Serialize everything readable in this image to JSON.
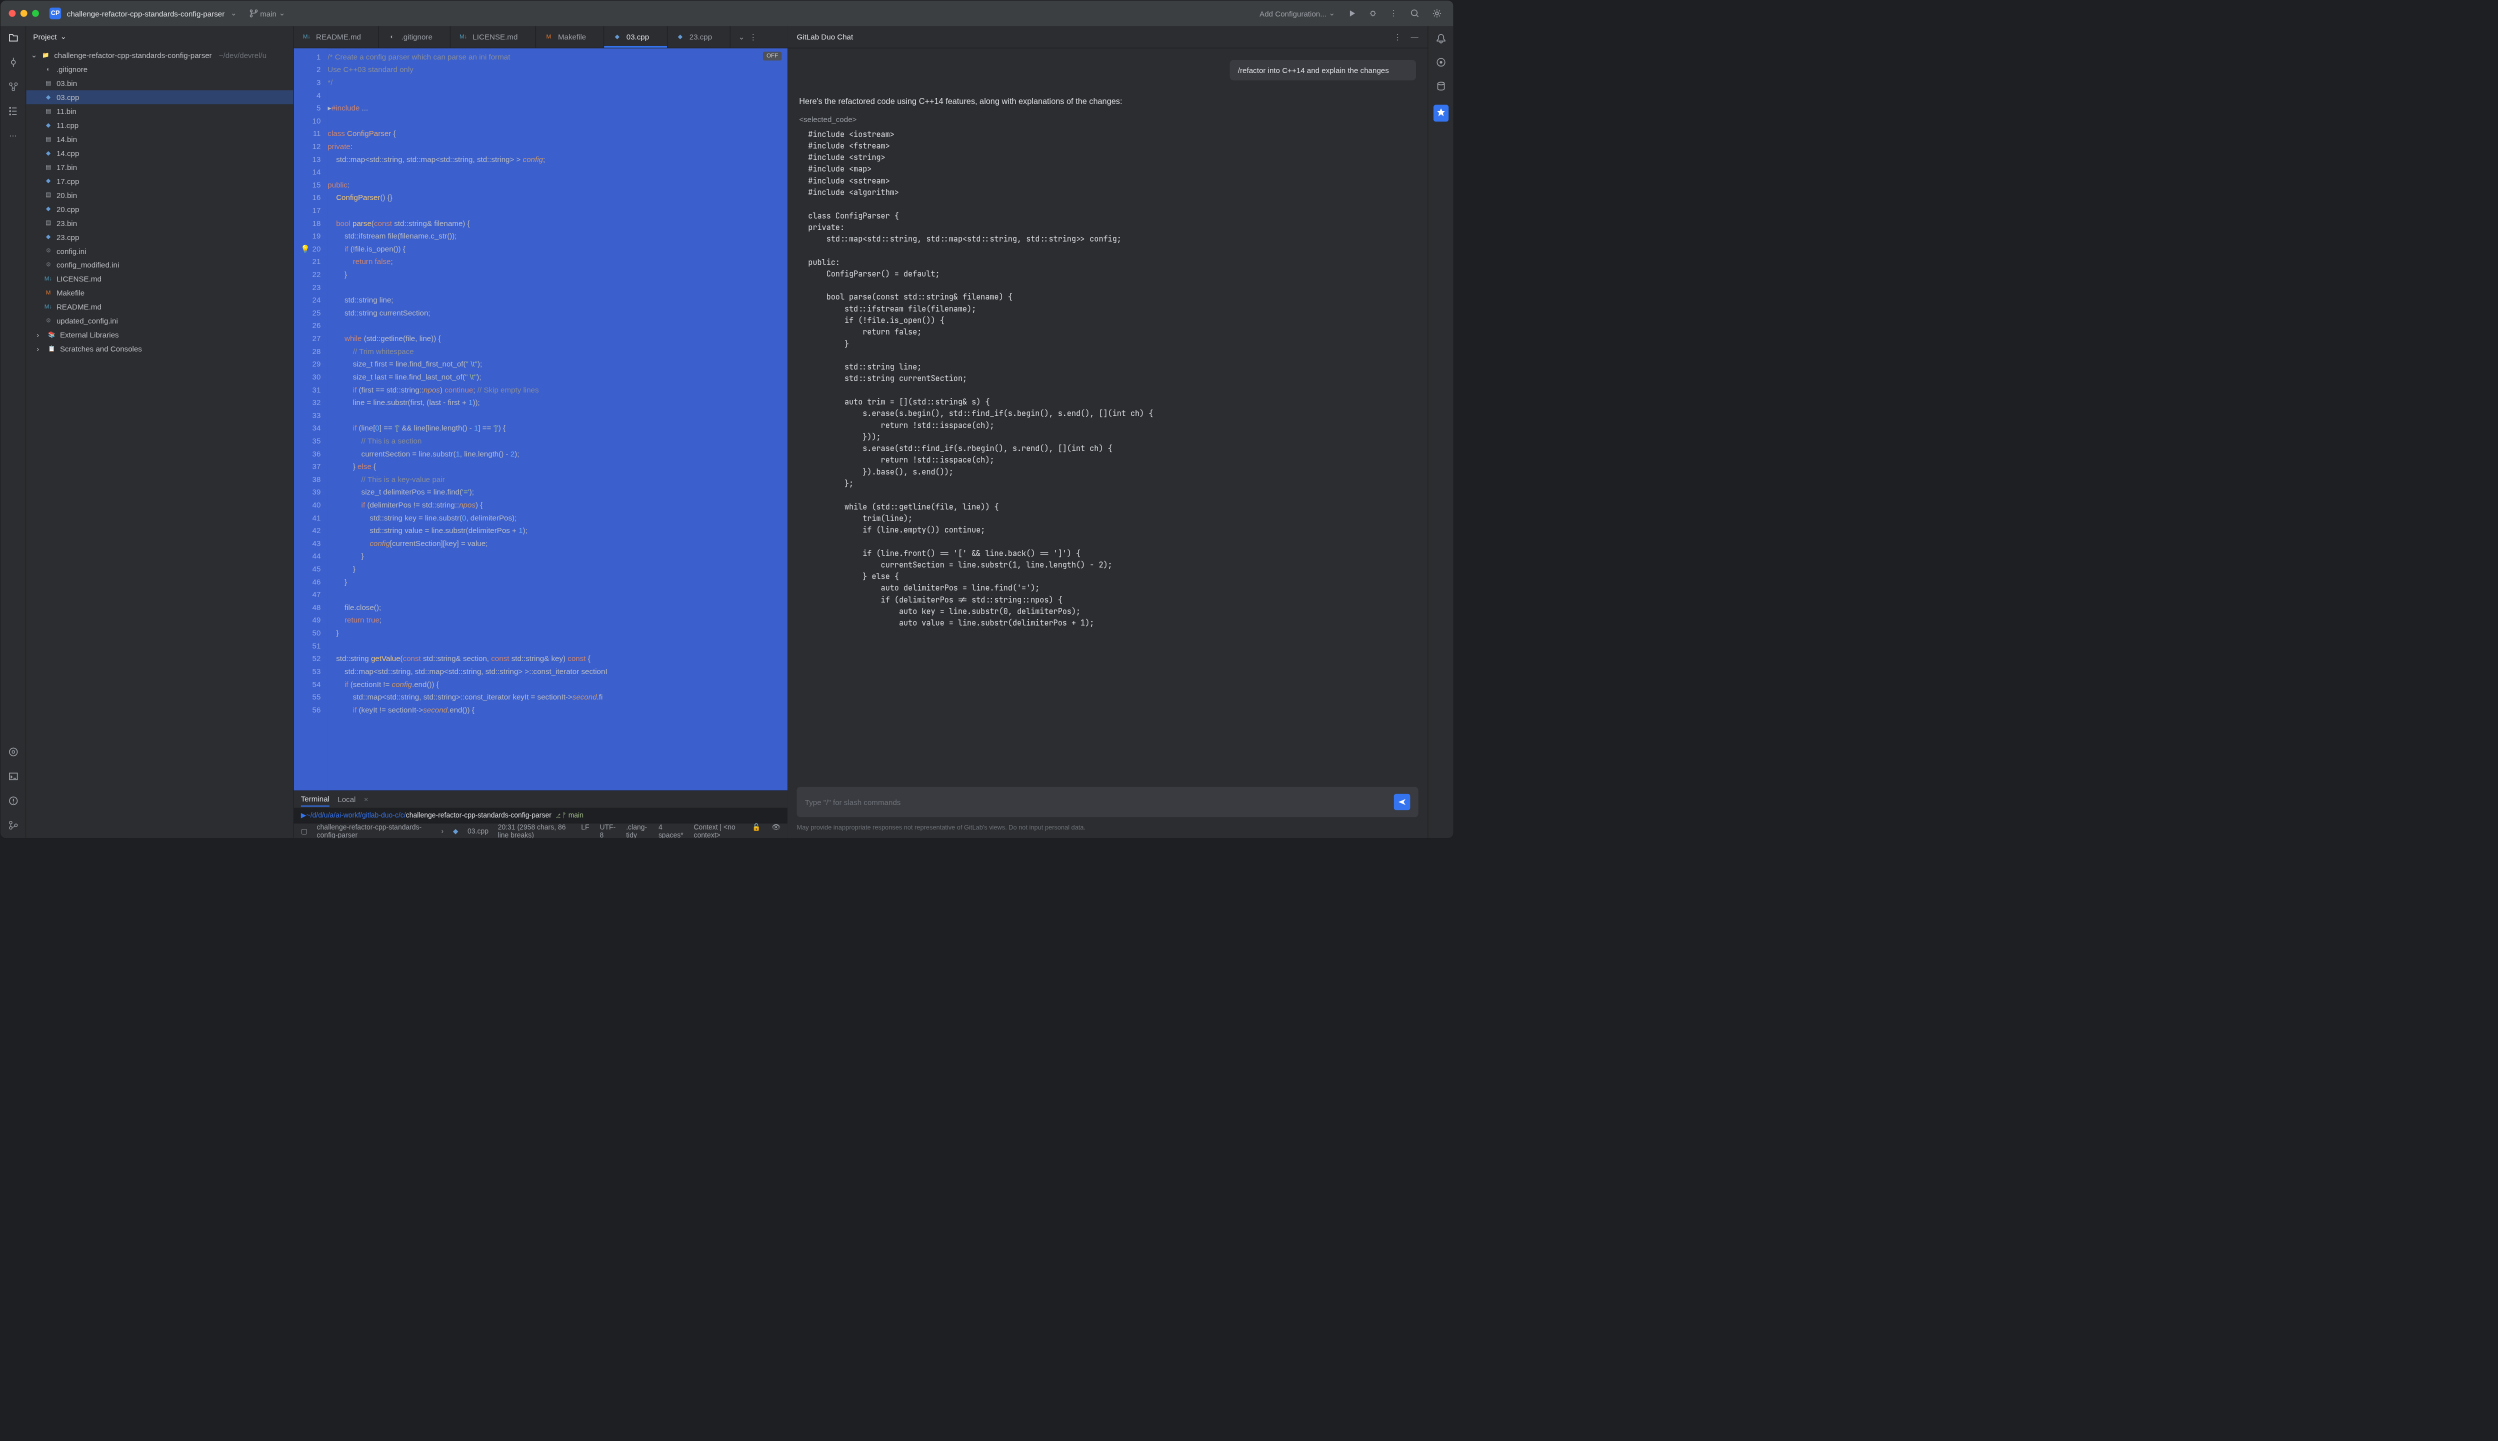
{
  "titlebar": {
    "project": "challenge-refactor-cpp-standards-config-parser",
    "badge": "CP",
    "branch": "main",
    "addConfig": "Add Configuration..."
  },
  "sidebar": {
    "header": "Project",
    "rootHint": "~/dev/devrel/u",
    "items": [
      {
        "name": ".gitignore",
        "icon": "file"
      },
      {
        "name": "03.bin",
        "icon": "bin"
      },
      {
        "name": "03.cpp",
        "icon": "cpp",
        "selected": true
      },
      {
        "name": "11.bin",
        "icon": "bin"
      },
      {
        "name": "11.cpp",
        "icon": "cpp"
      },
      {
        "name": "14.bin",
        "icon": "bin"
      },
      {
        "name": "14.cpp",
        "icon": "cpp"
      },
      {
        "name": "17.bin",
        "icon": "bin"
      },
      {
        "name": "17.cpp",
        "icon": "cpp"
      },
      {
        "name": "20.bin",
        "icon": "bin"
      },
      {
        "name": "20.cpp",
        "icon": "cpp"
      },
      {
        "name": "23.bin",
        "icon": "bin"
      },
      {
        "name": "23.cpp",
        "icon": "cpp"
      },
      {
        "name": "config.ini",
        "icon": "ini"
      },
      {
        "name": "config_modified.ini",
        "icon": "ini"
      },
      {
        "name": "LICENSE.md",
        "icon": "md"
      },
      {
        "name": "Makefile",
        "icon": "make"
      },
      {
        "name": "README.md",
        "icon": "md"
      },
      {
        "name": "updated_config.ini",
        "icon": "ini"
      }
    ],
    "libs": "External Libraries",
    "scratches": "Scratches and Consoles"
  },
  "tabs": [
    {
      "label": "README.md",
      "icon": "md"
    },
    {
      "label": ".gitignore",
      "icon": "file"
    },
    {
      "label": "LICENSE.md",
      "icon": "md"
    },
    {
      "label": "Makefile",
      "icon": "make"
    },
    {
      "label": "03.cpp",
      "icon": "cpp",
      "active": true
    },
    {
      "label": "23.cpp",
      "icon": "cpp"
    }
  ],
  "editor": {
    "offBadge": "OFF",
    "lines": [
      {
        "n": 1,
        "html": "<span class='cm-comment'>/* Create a config parser which can parse an ini format</span>"
      },
      {
        "n": 2,
        "html": "<span class='cm-comment'>Use C++03 standard only</span>"
      },
      {
        "n": 3,
        "html": "<span class='cm-comment'>*/</span>"
      },
      {
        "n": 4,
        "html": ""
      },
      {
        "n": 5,
        "html": "<span class='cm-op'>▸</span><span class='cm-keyword'>#include</span> ..."
      },
      {
        "n": 10,
        "html": ""
      },
      {
        "n": 11,
        "html": "<span class='cm-keyword'>class</span> <span class='cm-type'>ConfigParser</span> {"
      },
      {
        "n": 12,
        "html": "<span class='cm-keyword'>private</span>:"
      },
      {
        "n": 13,
        "html": "    std::map&lt;std::string, std::map&lt;std::string, std::string&gt; &gt; <span class='cm-npos'>config</span>;"
      },
      {
        "n": 14,
        "html": ""
      },
      {
        "n": 15,
        "html": "<span class='cm-keyword'>public</span>:"
      },
      {
        "n": 16,
        "html": "    <span class='cm-fn'>ConfigParser</span>() {}"
      },
      {
        "n": 17,
        "html": ""
      },
      {
        "n": 18,
        "html": "    <span class='cm-keyword'>bool</span> <span class='cm-fn'>parse</span>(<span class='cm-keyword'>const</span> std::string&amp; filename) {"
      },
      {
        "n": 19,
        "html": "        std::ifstream file(filename.c_str());"
      },
      {
        "n": 20,
        "html": "        <span class='cm-keyword'>if</span> (!file.is_open()) {",
        "bulb": true
      },
      {
        "n": 21,
        "html": "            <span class='cm-keyword'>return</span> <span class='cm-keyword'>false</span>;"
      },
      {
        "n": 22,
        "html": "        }"
      },
      {
        "n": 23,
        "html": ""
      },
      {
        "n": 24,
        "html": "        std::string line;"
      },
      {
        "n": 25,
        "html": "        std::string currentSection;"
      },
      {
        "n": 26,
        "html": ""
      },
      {
        "n": 27,
        "html": "        <span class='cm-keyword'>while</span> (std::getline(file, line)) {"
      },
      {
        "n": 28,
        "html": "            <span class='cm-comment'>// Trim whitespace</span>"
      },
      {
        "n": 29,
        "html": "            size_t first = line.find_first_not_of(<span class='cm-str'>\" \\t\"</span>);"
      },
      {
        "n": 30,
        "html": "            size_t last = line.find_last_not_of(<span class='cm-str'>\" \\t\"</span>);"
      },
      {
        "n": 31,
        "html": "            <span class='cm-keyword'>if</span> (first == std::string::<span class='cm-npos'>npos</span>) <span class='cm-keyword'>continue</span>; <span class='cm-comment'>// Skip empty lines</span>"
      },
      {
        "n": 32,
        "html": "            line = line.substr(first, (last - first + <span class='cm-num'>1</span>));"
      },
      {
        "n": 33,
        "html": ""
      },
      {
        "n": 34,
        "html": "            <span class='cm-keyword'>if</span> (line[<span class='cm-num'>0</span>] == <span class='cm-str'>'['</span> &amp;&amp; line[line.length() - <span class='cm-num'>1</span>] == <span class='cm-str'>']'</span>) {"
      },
      {
        "n": 35,
        "html": "                <span class='cm-comment'>// This is a section</span>"
      },
      {
        "n": 36,
        "html": "                currentSection = line.substr(<span class='cm-num'>1</span>, line.length() - <span class='cm-num'>2</span>);"
      },
      {
        "n": 37,
        "html": "            } <span class='cm-keyword'>else</span> {"
      },
      {
        "n": 38,
        "html": "                <span class='cm-comment'>// This is a key-value pair</span>"
      },
      {
        "n": 39,
        "html": "                size_t delimiterPos = line.find(<span class='cm-str'>'='</span>);"
      },
      {
        "n": 40,
        "html": "                <span class='cm-keyword'>if</span> (delimiterPos != std::string::<span class='cm-npos'>npos</span>) {"
      },
      {
        "n": 41,
        "html": "                    std::string key = line.substr(<span class='cm-num'>0</span>, delimiterPos);"
      },
      {
        "n": 42,
        "html": "                    std::string value = line.substr(delimiterPos + <span class='cm-num'>1</span>);"
      },
      {
        "n": 43,
        "html": "                    <span class='cm-npos'>config</span>[currentSection][key] = value;"
      },
      {
        "n": 44,
        "html": "                }"
      },
      {
        "n": 45,
        "html": "            }"
      },
      {
        "n": 46,
        "html": "        }"
      },
      {
        "n": 47,
        "html": ""
      },
      {
        "n": 48,
        "html": "        file.close();"
      },
      {
        "n": 49,
        "html": "        <span class='cm-keyword'>return</span> <span class='cm-keyword'>true</span>;"
      },
      {
        "n": 50,
        "html": "    }"
      },
      {
        "n": 51,
        "html": ""
      },
      {
        "n": 52,
        "html": "    std::string <span class='cm-fn'>getValue</span>(<span class='cm-keyword'>const</span> std::string&amp; section, <span class='cm-keyword'>const</span> std::string&amp; key) <span class='cm-keyword'>const</span> {"
      },
      {
        "n": 53,
        "html": "        std::map&lt;std::string, std::map&lt;std::string, std::string&gt; &gt;::const_iterator sectionI"
      },
      {
        "n": 54,
        "html": "        <span class='cm-keyword'>if</span> (sectionIt != <span class='cm-npos'>config</span>.end()) {"
      },
      {
        "n": 55,
        "html": "            std::map&lt;std::string, std::string&gt;::const_iterator keyIt = sectionIt-&gt;<span class='cm-npos'>second</span>.fi"
      },
      {
        "n": 56,
        "html": "            <span class='cm-keyword'>if</span> (keyIt != sectionIt-&gt;<span class='cm-npos'>second</span>.end()) {"
      }
    ]
  },
  "chat": {
    "title": "GitLab Duo Chat",
    "userMsg": "/refactor into C++14 and explain the changes",
    "aiIntro": "Here's the refactored code using C++14 features, along with explanations of the changes:",
    "aiTag": "<selected_code>",
    "aiCode": "  #include <iostream>\n  #include <fstream>\n  #include <string>\n  #include <map>\n  #include <sstream>\n  #include <algorithm>\n\n  class ConfigParser {\n  private:\n      std::map<std::string, std::map<std::string, std::string>> config;\n\n  public:\n      ConfigParser() = default;\n\n      bool parse(const std::string& filename) {\n          std::ifstream file(filename);\n          if (!file.is_open()) {\n              return false;\n          }\n\n          std::string line;\n          std::string currentSection;\n\n          auto trim = [](std::string& s) {\n              s.erase(s.begin(), std::find_if(s.begin(), s.end(), [](int ch) {\n                  return !std::isspace(ch);\n              }));\n              s.erase(std::find_if(s.rbegin(), s.rend(), [](int ch) {\n                  return !std::isspace(ch);\n              }).base(), s.end());\n          };\n\n          while (std::getline(file, line)) {\n              trim(line);\n              if (line.empty()) continue;\n\n              if (line.front() == '[' && line.back() == ']') {\n                  currentSection = line.substr(1, line.length() - 2);\n              } else {\n                  auto delimiterPos = line.find('=');\n                  if (delimiterPos != std::string::npos) {\n                      auto key = line.substr(0, delimiterPos);\n                      auto value = line.substr(delimiterPos + 1);",
    "placeholder": "Type \"/\" for slash commands",
    "disclaimer": "May provide inappropriate responses not representative of GitLab's views. Do not input personal data."
  },
  "status": {
    "crumbs": "challenge-refactor-cpp-standards-config-parser",
    "crumbFile": "03.cpp",
    "pos": "20:31 (2958 chars, 86 line breaks)",
    "sep": "LF",
    "enc": "UTF-8",
    "lang": ".clang-tidy",
    "indent": "4 spaces*",
    "ctx": "Context | <no context>"
  },
  "terminal": {
    "tab1": "Terminal",
    "tab2": "Local",
    "path": "~/d/d/u/a/ai-workf/gitlab-duo-c/c/",
    "cwd": "challenge-refactor-cpp-standards-config-parser",
    "branch": "⎇ ᚠ main"
  }
}
